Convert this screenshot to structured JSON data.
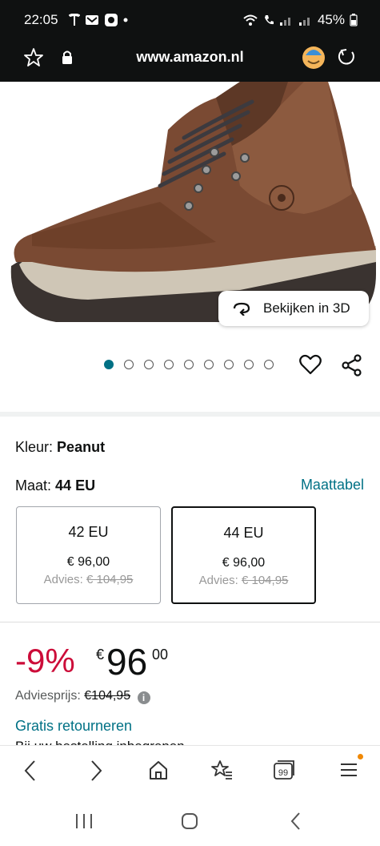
{
  "status_bar": {
    "time": "22:05",
    "battery": "45%"
  },
  "url_bar": {
    "url": "www.amazon.nl",
    "icons": [
      "star-icon",
      "lock-icon",
      "avatar-icon",
      "reload-icon"
    ]
  },
  "product_image": {
    "view_3d_label": "Bekijken in 3D",
    "image_count": 9,
    "active_index": 0
  },
  "variation": {
    "color_label": "Kleur:",
    "color_value": "Peanut",
    "size_label": "Maat:",
    "size_value": "44 EU",
    "size_chart_link": "Maattabel",
    "sizes": [
      {
        "size": "42 EU",
        "price": "€ 96,00",
        "advice_label": "Advies:",
        "advice_price": "€ 104,95",
        "selected": false
      },
      {
        "size": "44 EU",
        "price": "€ 96,00",
        "advice_label": "Advies:",
        "advice_price": "€ 104,95",
        "selected": true
      }
    ]
  },
  "pricing": {
    "discount": "-9%",
    "currency": "€",
    "whole": "96",
    "fraction": "00",
    "list_price_label": "Adviesprijs:",
    "list_price": "€104,95",
    "free_returns": "Gratis retourneren",
    "cutoff_text": "Bij uw bestelling inbegrepen"
  },
  "colors": {
    "link": "#007185",
    "discount": "#cc0c39",
    "dark": "#0f1111",
    "badge": "#f08804"
  }
}
